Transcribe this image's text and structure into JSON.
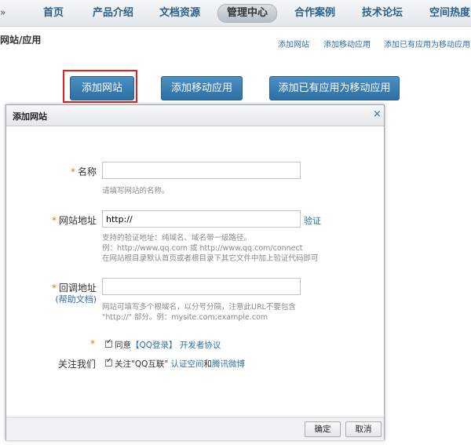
{
  "topnav": {
    "left_glyph": "»",
    "items": [
      "首页",
      "产品介绍",
      "文档资源",
      "管理中心",
      "合作案例",
      "技术论坛",
      "空间热度"
    ],
    "active": "管理中心"
  },
  "subbar": {
    "title": "网站/应用",
    "links": [
      "添加网站",
      "添加移动应用",
      "添加已有应用为移动应用"
    ]
  },
  "actions": {
    "add_site": "添加网站",
    "add_mobile_app": "添加移动应用",
    "add_existing_as_mobile": "添加已有应用为移动应用"
  },
  "dialog": {
    "title": "添加网站",
    "close": "×",
    "star": "*",
    "name": {
      "label": "名称",
      "value": "",
      "hint": "请填写网站的名称。"
    },
    "url": {
      "label": "网站地址",
      "value": "http://",
      "verify": "验证",
      "hints": [
        "支持的验证地址：纯域名、域名带一级路径。",
        "例：http://www.qq.com 或 http://www.qq.com/connect",
        "在网站根目录默认首页或者根目录下其它文件中加上验证代码即可"
      ]
    },
    "callback": {
      "label": "回调地址",
      "help": "(帮助文档)",
      "value": "",
      "hints": [
        "网站可填写多个根域名，以分号分隔，注意此URL不要包含",
        "\"http://\" 部分。例：mysite.com;example.com"
      ]
    },
    "agree": {
      "checked": true,
      "text": "同意",
      "link": "【QQ登录】",
      "suffix": "开发者协议"
    },
    "follow": {
      "label": "关注我们",
      "checked": true,
      "text": "关注\"QQ互联\"",
      "link1": "认证空间",
      "and": "和",
      "link2": "腾讯微博"
    },
    "ok": "确定",
    "cancel": "取消"
  }
}
